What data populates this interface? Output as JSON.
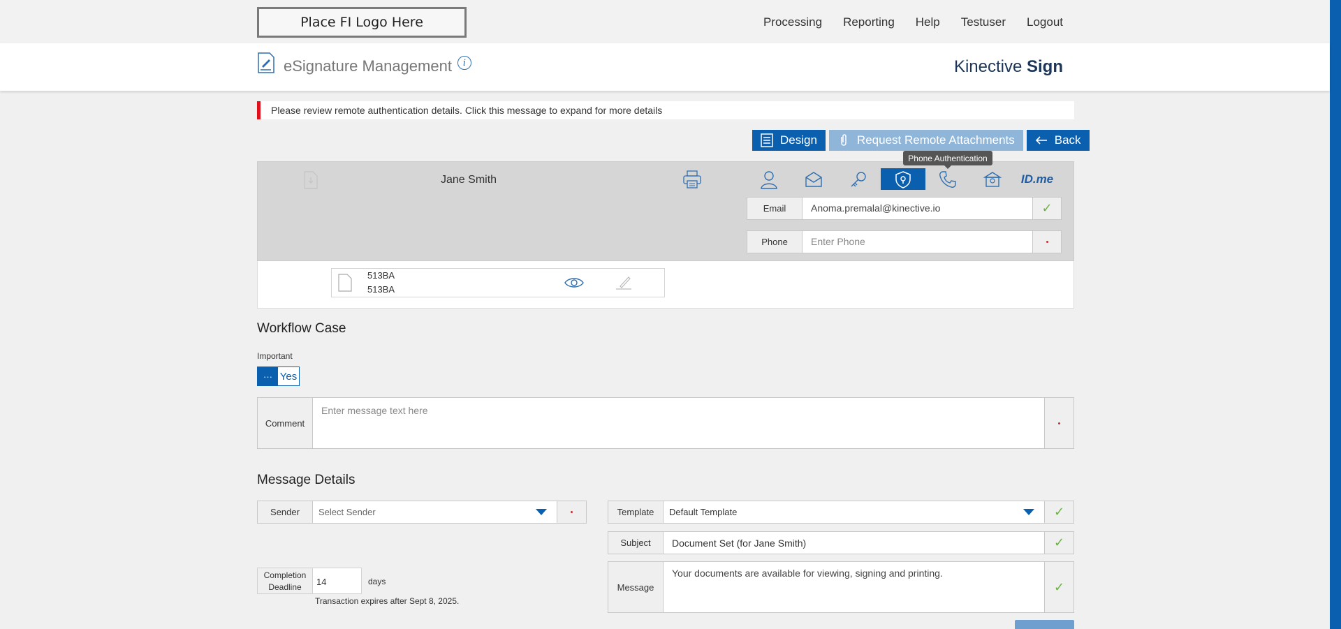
{
  "top": {
    "logo": "Place FI Logo Here",
    "nav": [
      "Processing",
      "Reporting",
      "Help",
      "Testuser",
      "Logout"
    ]
  },
  "header": {
    "title": "eSignature Management",
    "info": "i",
    "brand_light": "Kinective",
    "brand_bold": "Sign"
  },
  "alert": {
    "text": "Please review remote authentication details. Click this message to expand for more details"
  },
  "actions": {
    "design": "Design",
    "request_attachments": "Request Remote Attachments",
    "back": "Back"
  },
  "tooltip": "Phone Authentication",
  "signer": {
    "name": "Jane Smith",
    "auth_tabs": [
      "person-icon",
      "email-icon",
      "key-icon",
      "shield-lock-icon",
      "phone-icon",
      "bank-icon",
      "idme-icon"
    ],
    "idme_label": "ID.me",
    "email_label": "Email",
    "email_value": "Anoma.premalal@kinective.io",
    "phone_label": "Phone",
    "phone_placeholder": "Enter Phone"
  },
  "document": {
    "line1": "513BA",
    "line2": "513BA"
  },
  "workflow": {
    "title": "Workflow Case",
    "important_label": "Important",
    "toggle_knob": "···",
    "toggle_value": "Yes",
    "comment_label": "Comment",
    "comment_placeholder": "Enter message text here"
  },
  "message": {
    "title": "Message Details",
    "sender_label": "Sender",
    "sender_placeholder": "Select Sender",
    "template_label": "Template",
    "template_value": "Default Template",
    "subject_label": "Subject",
    "subject_value": "Document Set (for Jane Smith)",
    "deadline_label": "Completion Deadline",
    "deadline_value": "14",
    "deadline_unit": "days",
    "expiry": "Transaction expires after Sept 8, 2025.",
    "message_label": "Message",
    "message_value": "Your documents are available for viewing, signing and printing."
  },
  "colors": {
    "primary": "#0a5fae",
    "primary_disabled": "#8fb5d8",
    "alert": "#e0111a",
    "ok": "#6bb240"
  }
}
